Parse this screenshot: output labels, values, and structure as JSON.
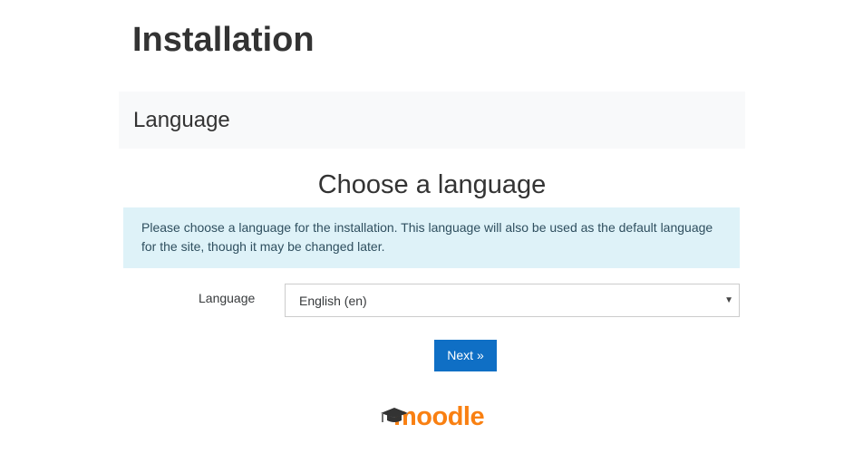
{
  "page": {
    "title": "Installation"
  },
  "section": {
    "header": "Language"
  },
  "main": {
    "heading": "Choose a language",
    "info": "Please choose a language for the installation. This language will also be used as the default language for the site, though it may be changed later.",
    "language_label": "Language",
    "language_value": "English (en)",
    "next_label": "Next »"
  },
  "footer": {
    "logo_text": "moodle",
    "logo_icon": "graduation-cap-icon"
  },
  "colors": {
    "primary_button": "#0f6fc5",
    "info_background": "#def2f8",
    "logo_orange": "#f98012",
    "header_background": "#f8f9fa"
  }
}
